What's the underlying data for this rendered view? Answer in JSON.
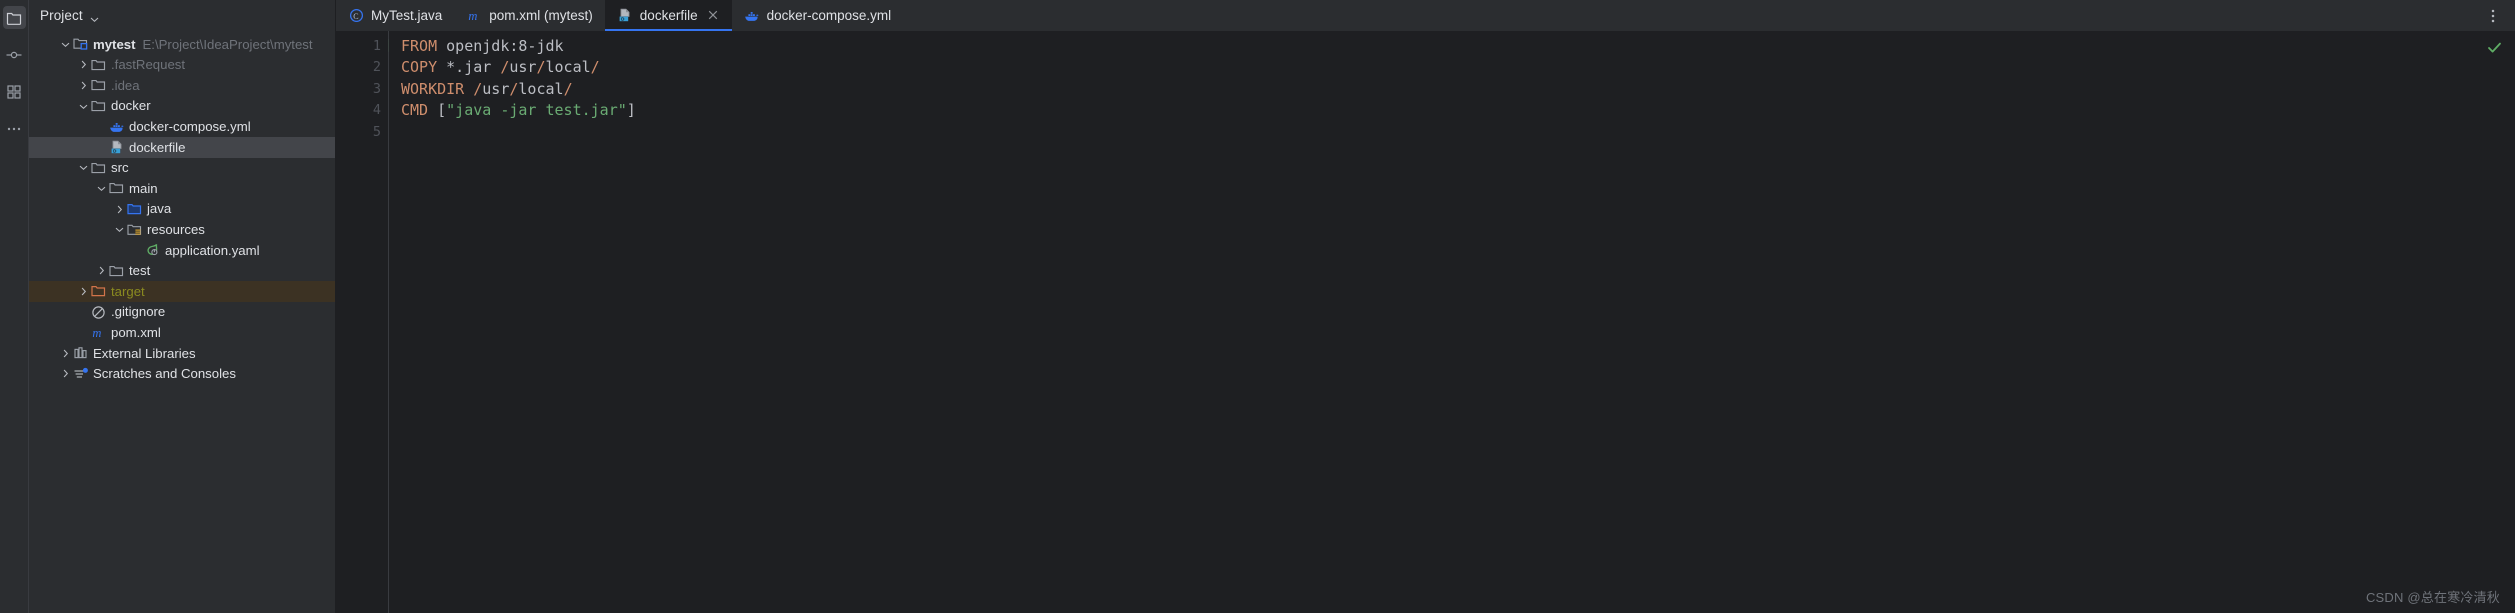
{
  "window": {
    "theme_bg": "#2b2d30",
    "editor_bg": "#1e1f22",
    "accent": "#3574f0",
    "selection_bg": "#43454a",
    "excluded_bg": "#3c3223"
  },
  "rail": {
    "items": [
      {
        "name": "project-tool-window-icon",
        "icon": "folder-icon",
        "active": true
      },
      {
        "name": "commit-tool-window-icon",
        "icon": "commit-icon",
        "active": false
      },
      {
        "name": "structure-tool-window-icon",
        "icon": "structure-icon",
        "active": false
      },
      {
        "name": "more-tool-windows-icon",
        "icon": "more-dots-icon",
        "active": false
      }
    ]
  },
  "project_panel": {
    "title": "Project",
    "dropdown_icon": "chevron-down-icon",
    "tree": [
      {
        "depth": 0,
        "twisty": "expanded",
        "icon": "module-folder-icon",
        "label": "mytest",
        "bold": true,
        "hint": "E:\\Project\\IdeaProject\\mytest",
        "state": "normal"
      },
      {
        "depth": 1,
        "twisty": "collapsed",
        "icon": "folder-icon",
        "label": ".fastRequest",
        "bold": false,
        "hint": "",
        "state": "dim"
      },
      {
        "depth": 1,
        "twisty": "collapsed",
        "icon": "folder-icon",
        "label": ".idea",
        "bold": false,
        "hint": "",
        "state": "dim"
      },
      {
        "depth": 1,
        "twisty": "expanded",
        "icon": "folder-icon",
        "label": "docker",
        "bold": false,
        "hint": "",
        "state": "normal"
      },
      {
        "depth": 2,
        "twisty": "none",
        "icon": "docker-whale-icon",
        "label": "docker-compose.yml",
        "bold": false,
        "hint": "",
        "state": "normal"
      },
      {
        "depth": 2,
        "twisty": "none",
        "icon": "dockerfile-icon",
        "label": "dockerfile",
        "bold": false,
        "hint": "",
        "state": "selected"
      },
      {
        "depth": 1,
        "twisty": "expanded",
        "icon": "folder-icon",
        "label": "src",
        "bold": false,
        "hint": "",
        "state": "normal"
      },
      {
        "depth": 2,
        "twisty": "expanded",
        "icon": "folder-icon",
        "label": "main",
        "bold": false,
        "hint": "",
        "state": "normal"
      },
      {
        "depth": 3,
        "twisty": "collapsed",
        "icon": "source-root-folder-icon",
        "label": "java",
        "bold": false,
        "hint": "",
        "state": "normal"
      },
      {
        "depth": 3,
        "twisty": "expanded",
        "icon": "resource-root-folder-icon",
        "label": "resources",
        "bold": false,
        "hint": "",
        "state": "normal"
      },
      {
        "depth": 4,
        "twisty": "none",
        "icon": "spring-leaf-icon",
        "label": "application.yaml",
        "bold": false,
        "hint": "",
        "state": "normal"
      },
      {
        "depth": 2,
        "twisty": "collapsed",
        "icon": "folder-icon",
        "label": "test",
        "bold": false,
        "hint": "",
        "state": "normal"
      },
      {
        "depth": 1,
        "twisty": "collapsed",
        "icon": "excluded-folder-icon",
        "label": "target",
        "bold": false,
        "hint": "",
        "state": "excluded"
      },
      {
        "depth": 1,
        "twisty": "none",
        "icon": "gitignore-icon",
        "label": ".gitignore",
        "bold": false,
        "hint": "",
        "state": "normal"
      },
      {
        "depth": 1,
        "twisty": "none",
        "icon": "maven-icon",
        "label": "pom.xml",
        "bold": false,
        "hint": "",
        "state": "normal"
      },
      {
        "depth": 0,
        "twisty": "collapsed",
        "icon": "libraries-icon",
        "label": "External Libraries",
        "bold": false,
        "hint": "",
        "state": "normal"
      },
      {
        "depth": 0,
        "twisty": "collapsed",
        "icon": "scratches-icon",
        "label": "Scratches and Consoles",
        "bold": false,
        "hint": "",
        "state": "normal"
      }
    ]
  },
  "editor": {
    "tabs": [
      {
        "label": "MyTest.java",
        "icon": "java-class-icon",
        "active": false,
        "closable": false
      },
      {
        "label": "pom.xml (mytest)",
        "icon": "maven-icon",
        "active": false,
        "closable": false
      },
      {
        "label": "dockerfile",
        "icon": "dockerfile-icon",
        "active": true,
        "closable": true,
        "close_icon": "close-icon"
      },
      {
        "label": "docker-compose.yml",
        "icon": "docker-whale-icon",
        "active": false,
        "closable": false
      }
    ],
    "options_icon": "more-vertical-icon",
    "gutter": {
      "line_numbers": [
        "1",
        "2",
        "3",
        "4",
        "5"
      ],
      "run_marker_line": 1,
      "run_marker_icon": "run-double-arrow-icon"
    },
    "inspection_status_icon": "check-ok-icon",
    "lines": [
      {
        "n": 1,
        "tokens": [
          {
            "t": "FROM",
            "c": "k"
          },
          {
            "t": " openjdk:8-jdk",
            "c": "t"
          }
        ]
      },
      {
        "n": 2,
        "tokens": [
          {
            "t": "COPY",
            "c": "k"
          },
          {
            "t": " *.jar ",
            "c": "t"
          },
          {
            "t": "/",
            "c": "p"
          },
          {
            "t": "usr",
            "c": "t"
          },
          {
            "t": "/",
            "c": "p"
          },
          {
            "t": "local",
            "c": "t"
          },
          {
            "t": "/",
            "c": "p"
          }
        ]
      },
      {
        "n": 3,
        "tokens": [
          {
            "t": "WORKDIR",
            "c": "k"
          },
          {
            "t": " ",
            "c": "t"
          },
          {
            "t": "/",
            "c": "p"
          },
          {
            "t": "usr",
            "c": "t"
          },
          {
            "t": "/",
            "c": "p"
          },
          {
            "t": "local",
            "c": "t"
          },
          {
            "t": "/",
            "c": "p"
          }
        ]
      },
      {
        "n": 4,
        "tokens": [
          {
            "t": "CMD",
            "c": "k"
          },
          {
            "t": " [",
            "c": "b"
          },
          {
            "t": "\"java -jar test.jar\"",
            "c": "s"
          },
          {
            "t": "]",
            "c": "b"
          }
        ]
      },
      {
        "n": 5,
        "tokens": []
      }
    ]
  },
  "watermark": {
    "text": "CSDN @总在寒冷清秋"
  }
}
